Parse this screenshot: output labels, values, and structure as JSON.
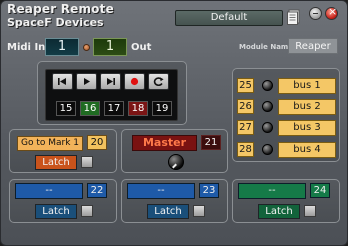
{
  "header": {
    "title": "Reaper Remote",
    "subtitle": "SpaceF Devices",
    "preset": "Default"
  },
  "midi": {
    "in_label": "Midi In",
    "in_value": "1",
    "out_label": "Out",
    "out_value": "1"
  },
  "module": {
    "label": "Module Name",
    "value": "Reaper"
  },
  "transport": {
    "buttons": [
      "rewind",
      "play",
      "forward",
      "record",
      "loop"
    ],
    "tracks": [
      {
        "label": "15",
        "color": "#0b0b0b"
      },
      {
        "label": "16",
        "color": "#1f6b22"
      },
      {
        "label": "17",
        "color": "#0b0b0b"
      },
      {
        "label": "18",
        "color": "#7b1515"
      },
      {
        "label": "19",
        "color": "#0b0b0b"
      }
    ]
  },
  "buses": [
    {
      "num": "25",
      "name": "bus 1"
    },
    {
      "num": "26",
      "name": "bus 2"
    },
    {
      "num": "27",
      "name": "bus 3"
    },
    {
      "num": "28",
      "name": "bus 4"
    }
  ],
  "marker": {
    "label": "Go to Mark 1",
    "num": "20",
    "latch": "Latch"
  },
  "master": {
    "label": "Master",
    "num": "21"
  },
  "tracks_bottom": [
    {
      "name": "--",
      "num": "22",
      "latch": "Latch",
      "color": "#1e5aa8",
      "latch_color": "#1a4f7a"
    },
    {
      "name": "--",
      "num": "23",
      "latch": "Latch",
      "color": "#1e5aa8",
      "latch_color": "#1a4f7a"
    },
    {
      "name": "--",
      "num": "24",
      "latch": "Latch",
      "color": "#157a48",
      "latch_color": "#12633b"
    }
  ],
  "colors": {
    "accent": "#f4c766",
    "marker": "#f2b35a",
    "master": "#7a1211",
    "latch_marker": "#c9531b"
  }
}
